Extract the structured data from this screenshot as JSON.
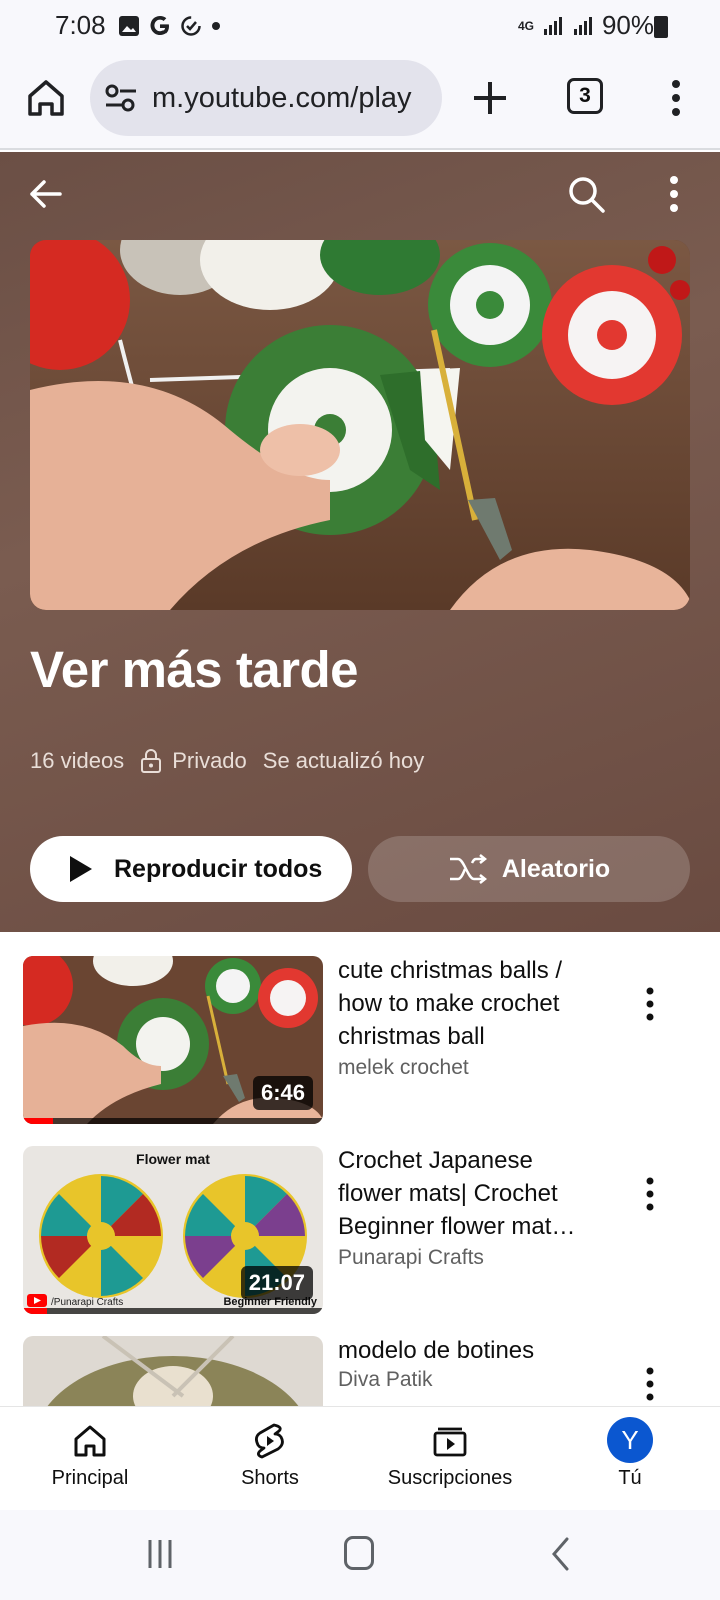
{
  "status_bar": {
    "time": "7:08",
    "network": "4G",
    "battery": "90%"
  },
  "browser": {
    "url": "m.youtube.com/play",
    "tab_count": "3"
  },
  "playlist": {
    "title": "Ver más tarde",
    "video_count": "16 videos",
    "privacy": "Privado",
    "updated": "Se actualizó hoy",
    "play_all_label": "Reproducir todos",
    "shuffle_label": "Aleatorio"
  },
  "videos": [
    {
      "title": "cute christmas balls / how to make crochet christmas ball",
      "channel": "melek crochet",
      "duration": "6:46",
      "progress": 0.1
    },
    {
      "title": "Crochet Japanese flower mats| Crochet Beginner flower mat…",
      "channel": "Punarapi Crafts",
      "duration": "21:07",
      "progress": 0.08,
      "thumb_text": {
        "heading": "Flower mat",
        "footer_left": "/Punarapi Crafts",
        "footer_right": "Beginner Friendly"
      }
    },
    {
      "title": "modelo de botines",
      "channel": "Diva Patik"
    }
  ],
  "bottom_nav": [
    {
      "label": "Principal",
      "icon": "home-icon"
    },
    {
      "label": "Shorts",
      "icon": "shorts-icon"
    },
    {
      "label": "Suscripciones",
      "icon": "subscriptions-icon"
    },
    {
      "label": "Tú",
      "icon": "avatar",
      "avatar_letter": "Y"
    }
  ],
  "colors": {
    "accent_red": "#ff0000",
    "avatar_blue": "#0b57d0",
    "hero_bg": "#6b4f45"
  }
}
